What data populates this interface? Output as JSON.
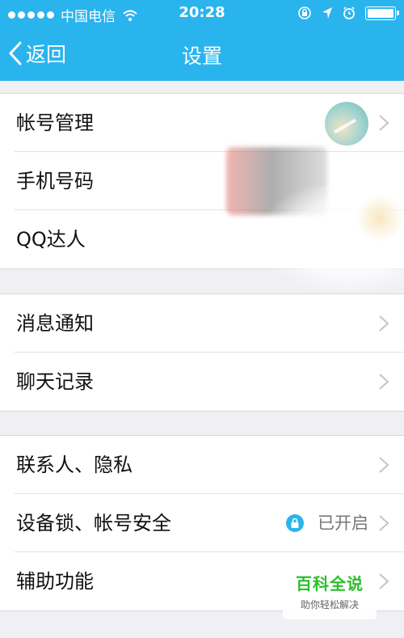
{
  "status_bar": {
    "carrier": "中国电信",
    "time": "20:28"
  },
  "nav": {
    "back_label": "返回",
    "title": "设置"
  },
  "groups": [
    {
      "items": [
        {
          "label": "帐号管理"
        },
        {
          "label": "手机号码"
        },
        {
          "label": "QQ达人"
        }
      ]
    },
    {
      "items": [
        {
          "label": "消息通知"
        },
        {
          "label": "聊天记录"
        }
      ]
    },
    {
      "items": [
        {
          "label": "联系人、隐私"
        },
        {
          "label": "设备锁、帐号安全",
          "value": "已开启"
        },
        {
          "label": "辅助功能"
        }
      ]
    }
  ],
  "watermark": {
    "title": "百科全说",
    "subtitle": "助你轻松解决"
  },
  "colors": {
    "accent": "#2ab4ee",
    "background": "#efeff4"
  }
}
